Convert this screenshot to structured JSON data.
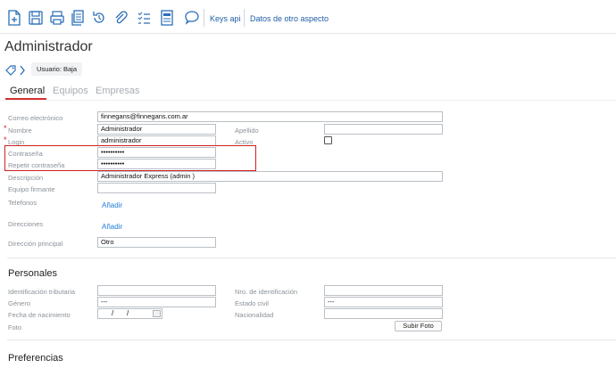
{
  "toolbar": {
    "icons": [
      "new-document-icon",
      "save-icon",
      "print-icon",
      "copy-icon",
      "history-icon",
      "attach-icon",
      "list-icon",
      "report-icon",
      "comment-icon"
    ],
    "links": {
      "keys_api": "Keys api",
      "other_aspect": "Datos de otro aspecto"
    },
    "accent": "#1f5fa8"
  },
  "header": {
    "title": "Administrador",
    "status": "Usuario: Baja"
  },
  "tabs": [
    {
      "label": "General",
      "active": true
    },
    {
      "label": "Equipos",
      "active": false
    },
    {
      "label": "Empresas",
      "active": false
    }
  ],
  "form": {
    "email": {
      "label": "Correo electrónico",
      "value": "finnegans@finnegans.com.ar"
    },
    "nombre": {
      "label": "Nombre",
      "value": "Administrador",
      "required": true
    },
    "apellido": {
      "label": "Apellido",
      "value": ""
    },
    "login": {
      "label": "Login",
      "value": "administrador",
      "required": true
    },
    "activo": {
      "label": "Activo",
      "checked": false
    },
    "contrasena": {
      "label": "Contraseña",
      "value": "••••••••••"
    },
    "repetir": {
      "label": "Repetir contraseña",
      "value": "••••••••••"
    },
    "descripcion": {
      "label": "Descripción",
      "value": "Administrador Express (admin )"
    },
    "equipo_firmante": {
      "label": "Equipo firmante",
      "value": ""
    },
    "telefonos": {
      "label": "Telefonos",
      "add_label": "Añadir"
    },
    "direcciones": {
      "label": "Direcciones",
      "add_label": "Añadir"
    },
    "direccion_principal": {
      "label": "Dirección principal",
      "value": "Otro"
    }
  },
  "personales": {
    "title": "Personales",
    "identificacion_tributaria": {
      "label": "Identificación tributaria",
      "value": ""
    },
    "nro_identificacion": {
      "label": "Nro. de identificación",
      "value": ""
    },
    "genero": {
      "label": "Género",
      "value": "---"
    },
    "estado_civil": {
      "label": "Estado civil",
      "value": "---"
    },
    "fecha_nacimiento": {
      "label": "Fecha de nacimiento",
      "sep1": "/",
      "sep2": "/"
    },
    "nacionalidad": {
      "label": "Nacionalidad",
      "value": ""
    },
    "foto": {
      "label": "Foto",
      "button": "Subir Foto"
    }
  },
  "preferencias": {
    "title": "Preferencias"
  },
  "colors": {
    "required": "#c62828",
    "highlight": "#d01f1f",
    "active_tab": "#d32f2f",
    "link": "#1f7ad6"
  }
}
